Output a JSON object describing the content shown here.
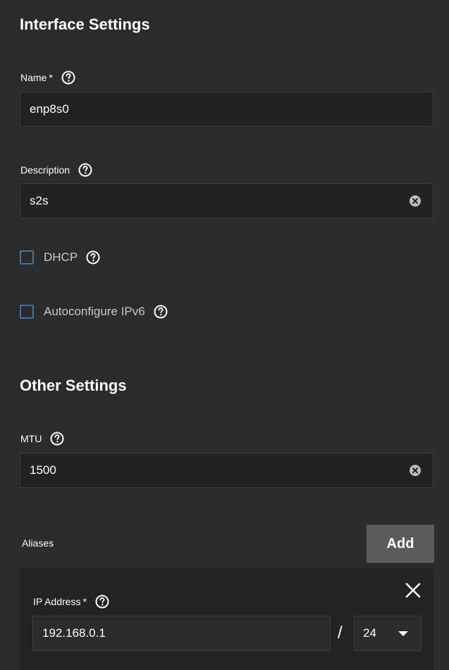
{
  "interface_settings": {
    "title": "Interface Settings",
    "name": {
      "label": "Name",
      "required_mark": "*",
      "value": "enp8s0"
    },
    "description": {
      "label": "Description",
      "value": "s2s"
    },
    "dhcp": {
      "label": "DHCP",
      "checked": false
    },
    "autoconfigure_ipv6": {
      "label": "Autoconfigure IPv6",
      "checked": false
    }
  },
  "other_settings": {
    "title": "Other Settings",
    "mtu": {
      "label": "MTU",
      "value": "1500"
    }
  },
  "aliases": {
    "label": "Aliases",
    "add_label": "Add",
    "items": [
      {
        "ip_label": "IP Address",
        "required_mark": "*",
        "ip_value": "192.168.0.1",
        "separator": "/",
        "netmask": "24"
      }
    ]
  },
  "colors": {
    "background": "#2b2b2b",
    "input_background": "#222222",
    "checkbox_border": "#3c75a6",
    "add_button": "#5b5b5b"
  },
  "icons": {
    "help": "help-circle-icon",
    "clear": "clear-circle-icon",
    "close": "close-icon",
    "dropdown": "caret-down-icon"
  }
}
